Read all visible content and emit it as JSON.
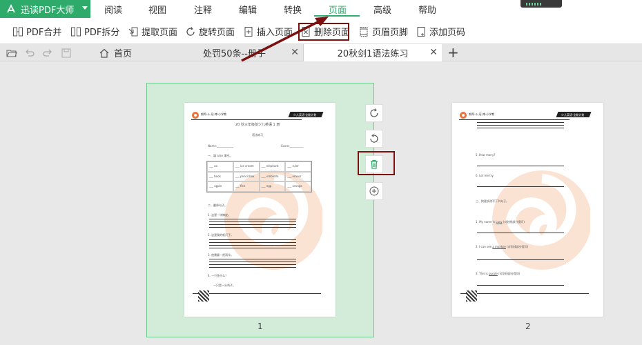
{
  "app": {
    "name": "迅读PDF大师"
  },
  "menu": [
    "阅读",
    "视图",
    "注释",
    "编辑",
    "转换",
    "页面",
    "高级",
    "帮助"
  ],
  "menu_active": "页面",
  "toolbar": {
    "merge": "PDF合并",
    "split": "PDF拆分",
    "extract": "提取页面",
    "rotate": "旋转页面",
    "insert": "插入页面",
    "delete": "删除页面",
    "header_footer": "页眉页脚",
    "page_number": "添加页码"
  },
  "tabs": {
    "home": "首页",
    "doc1": "处罚50条--册子",
    "doc2": "20秋剑1语法练习"
  },
  "pages": {
    "page1_number": "1",
    "page2_number": "2",
    "page1": {
      "school": "朗哥·斗·冠·博·小学教",
      "banner": "少儿英语·全能计划",
      "title": "20 秋三年级剑少儿英语 1 册",
      "subtitle": "语法练习",
      "name_label": "Name:____________",
      "score_label": "Score:__________",
      "section1": "一、填 a/an 填空。",
      "cells": [
        "___ ox",
        "___ ice cream",
        "___ elephant",
        "___ ruler",
        "___ book",
        "___ pencil box",
        "___ umbrella",
        "___ eraser",
        "___ apple",
        "___ fish",
        "___ egg",
        "___ orange"
      ],
      "section2": "二、翻译句子。",
      "q1": "1. 这是一块橡皮。",
      "q2": "2. 这是我的新尺子。",
      "q3": "3. 他需要一把雨伞。",
      "q4": "4. 一只鱼什么？",
      "q4b": "一只是一头鸡子。"
    },
    "page2": {
      "q5": "5. How many?",
      "q6": "6. Let me try.",
      "section3": "三、按要求改写下列句子。",
      "r1_a": "1. My name is",
      "r1_b": "Lucy",
      "r1_c": "(对划线部分提问)",
      "r2_a": "2. I can see",
      "r2_b": "a monkey",
      "r2_c": "(对划线部分提问)",
      "r3_a": "3. This is",
      "r3_b": "purple",
      "r3_c": "(对划线部分提问)"
    }
  },
  "colors": {
    "accent": "#2eaa6a",
    "highlight": "#7a1010",
    "selected_page": "#d3ecd9"
  }
}
